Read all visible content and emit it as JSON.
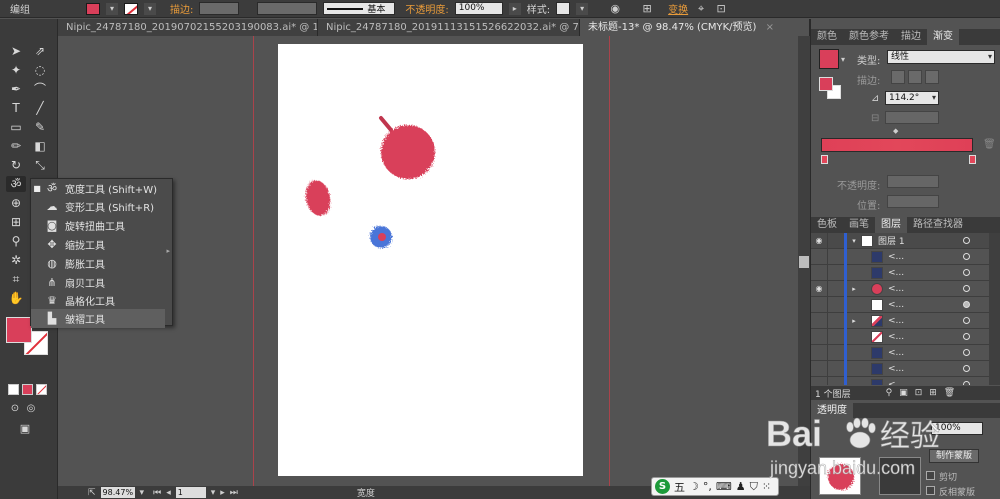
{
  "control_bar": {
    "group_label": "编组",
    "stroke_label": "描边:",
    "stroke_style": "基本",
    "opacity_label": "不透明度:",
    "opacity_value": "100%",
    "style_label": "样式:",
    "transform_label": "变换"
  },
  "tabs": [
    {
      "label": "Nipic_24787180_20190702155203190083.ai* @ 111...",
      "active": false
    },
    {
      "label": "Nipic_24787180_20191113151526622032.ai* @ 75...",
      "active": false
    },
    {
      "label": "未标题-13* @ 98.47% (CMYK/预览)",
      "active": true
    }
  ],
  "flyout": {
    "items": [
      {
        "label": "宽度工具 (Shift+W)",
        "icon": "width-tool-icon",
        "selected": true
      },
      {
        "label": "变形工具 (Shift+R)",
        "icon": "warp-tool-icon",
        "selected": false
      },
      {
        "label": "旋转扭曲工具",
        "icon": "twirl-tool-icon",
        "selected": false
      },
      {
        "label": "缩拢工具",
        "icon": "pucker-tool-icon",
        "selected": false
      },
      {
        "label": "膨胀工具",
        "icon": "bloat-tool-icon",
        "selected": false
      },
      {
        "label": "扇贝工具",
        "icon": "scallop-tool-icon",
        "selected": false
      },
      {
        "label": "晶格化工具",
        "icon": "crystallize-tool-icon",
        "selected": false
      },
      {
        "label": "皱褶工具",
        "icon": "wrinkle-tool-icon",
        "selected": false,
        "hover": true
      }
    ]
  },
  "right_panel": {
    "top_tabs": [
      "颜色",
      "颜色参考",
      "描边",
      "渐变"
    ],
    "gradient": {
      "type_label": "类型:",
      "type_value": "线性",
      "stroke_label": "描边:",
      "angle_value": "114.2°",
      "opacity_label": "不透明度:",
      "location_label": "位置:",
      "color": "#e2475a"
    },
    "layer_tabs": [
      "色板",
      "画笔",
      "图层",
      "路径查找器"
    ],
    "layers": {
      "header_name": "图层 1",
      "rows": [
        {
          "name": "<...",
          "thumb": "navy",
          "eye": false,
          "expand": false
        },
        {
          "name": "<...",
          "thumb": "navy",
          "eye": false,
          "expand": false
        },
        {
          "name": "<...",
          "thumb": "red",
          "eye": true,
          "expand": true
        },
        {
          "name": "<...",
          "thumb": "white",
          "eye": false,
          "expand": false
        },
        {
          "name": "<...",
          "thumb": "redline",
          "eye": false,
          "expand": true
        },
        {
          "name": "<...",
          "thumb": "redline",
          "eye": false,
          "expand": false
        },
        {
          "name": "<...",
          "thumb": "navy",
          "eye": false,
          "expand": false
        },
        {
          "name": "<...",
          "thumb": "navy",
          "eye": false,
          "expand": false
        },
        {
          "name": "<...",
          "thumb": "navy",
          "eye": false,
          "expand": false
        }
      ],
      "footer_count": "1 个图层"
    },
    "transparency": {
      "tabs": [
        "透明度"
      ],
      "opacity_value": "100%",
      "make_mask_label": "制作蒙版",
      "clip_label": "剪切",
      "invert_label": "反相蒙版"
    }
  },
  "status_bar": {
    "zoom": "98.47%",
    "page": "1",
    "tool_name": "宽度"
  },
  "ime": {
    "logo": "S",
    "mode": "五"
  },
  "watermark": {
    "brand": "Bai",
    "brand_suffix": "经验",
    "url": "jingyan.baidu.com"
  },
  "colors": {
    "accent_red": "#d93f5a",
    "guide_red": "#c0404a",
    "blue_blob": "#4a74d8",
    "layer_blue": "#2f5fd0"
  }
}
